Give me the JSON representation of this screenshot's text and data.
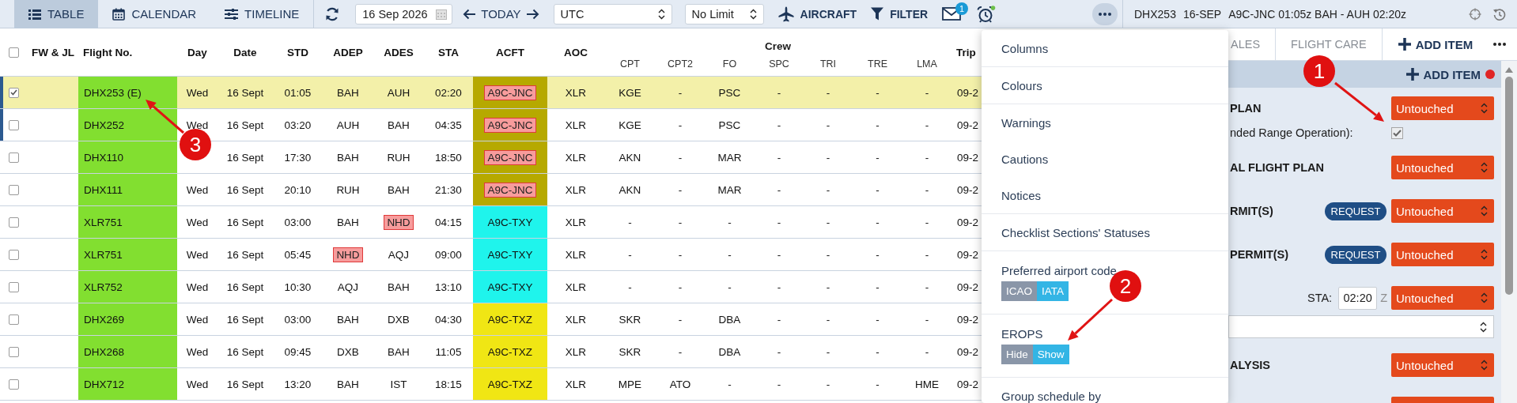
{
  "toolbar": {
    "views": [
      {
        "kind": "table",
        "label": "TABLE",
        "selected": true
      },
      {
        "kind": "calendar",
        "label": "CALENDAR",
        "selected": false
      },
      {
        "kind": "timeline",
        "label": "TIMELINE",
        "selected": false
      }
    ],
    "date": "16 Sep 2026",
    "today": "TODAY",
    "timezone": "UTC",
    "limit": "No Limit",
    "aircraft": "AIRCRAFT",
    "filter": "FILTER",
    "messages_badge": "1"
  },
  "flight_info": [
    "DHX253",
    "16-SEP",
    "A9C-JNC 01:05z BAH - AUH 02:20z"
  ],
  "table": {
    "all_selected": false,
    "columns": [
      "FW & JL",
      "Flight No.",
      "Day",
      "Date",
      "STD",
      "ADEP",
      "ADES",
      "STA",
      "ACFT",
      "AOC"
    ],
    "crew_group": {
      "label": "Crew",
      "columns": [
        "CPT",
        "CPT2",
        "FO",
        "SPC",
        "TRI",
        "TRE",
        "LMA"
      ]
    },
    "trip_column": "Trip",
    "rows": [
      {
        "selected": true,
        "marked": true,
        "flight": "DHX253 (E)",
        "day": "Wed",
        "date": "16 Sept",
        "std": "01:05",
        "adep": "BAH",
        "adep_alert": false,
        "ades": "AUH",
        "ades_alert": false,
        "sta": "02:20",
        "acft": "A9C-JNC",
        "acft_alert": true,
        "color": "#b6a900",
        "aoc": "XLR",
        "crew": [
          "KGE",
          "-",
          "PSC",
          "-",
          "-",
          "-",
          "-"
        ],
        "trip": "09-2"
      },
      {
        "selected": false,
        "marked": true,
        "flight": "DHX252",
        "day": "Wed",
        "date": "16 Sept",
        "std": "03:20",
        "adep": "AUH",
        "adep_alert": false,
        "ades": "BAH",
        "ades_alert": false,
        "sta": "04:35",
        "acft": "A9C-JNC",
        "acft_alert": true,
        "color": "#b6a900",
        "aoc": "XLR",
        "crew": [
          "KGE",
          "-",
          "PSC",
          "-",
          "-",
          "-",
          "-"
        ],
        "trip": "09-2"
      },
      {
        "selected": false,
        "marked": false,
        "flight": "DHX110",
        "date": "16 Sept",
        "std": "17:30",
        "adep": "BAH",
        "adep_alert": false,
        "ades": "RUH",
        "ades_alert": false,
        "sta": "18:50",
        "acft": "A9C-JNC",
        "acft_alert": true,
        "color": "#b6a900",
        "aoc": "XLR",
        "crew": [
          "AKN",
          "-",
          "MAR",
          "-",
          "-",
          "-",
          "-"
        ],
        "trip": "09-2"
      },
      {
        "selected": false,
        "marked": false,
        "flight": "DHX111",
        "day": "Wed",
        "date": "16 Sept",
        "std": "20:10",
        "adep": "RUH",
        "adep_alert": false,
        "ades": "BAH",
        "ades_alert": false,
        "sta": "21:30",
        "acft": "A9C-JNC",
        "acft_alert": true,
        "color": "#b6a900",
        "aoc": "XLR",
        "crew": [
          "AKN",
          "-",
          "MAR",
          "-",
          "-",
          "-",
          "-"
        ],
        "trip": "09-2"
      },
      {
        "selected": false,
        "marked": false,
        "flight": "XLR751",
        "day": "Wed",
        "date": "16 Sept",
        "std": "03:00",
        "adep": "BAH",
        "adep_alert": false,
        "ades": "NHD",
        "ades_alert": true,
        "sta": "04:15",
        "acft": "A9C-TXY",
        "acft_alert": false,
        "color": "#1ff4ec",
        "aoc": "XLR",
        "crew": [
          "-",
          "-",
          "-",
          "-",
          "-",
          "-",
          "-"
        ],
        "trip": "09-2"
      },
      {
        "selected": false,
        "marked": false,
        "flight": "XLR751",
        "day": "Wed",
        "date": "16 Sept",
        "std": "05:45",
        "adep": "NHD",
        "adep_alert": true,
        "ades": "AQJ",
        "ades_alert": false,
        "sta": "09:00",
        "acft": "A9C-TXY",
        "acft_alert": false,
        "color": "#1ff4ec",
        "aoc": "XLR",
        "crew": [
          "-",
          "-",
          "-",
          "-",
          "-",
          "-",
          "-"
        ],
        "trip": "09-2"
      },
      {
        "selected": false,
        "marked": false,
        "flight": "XLR752",
        "day": "Wed",
        "date": "16 Sept",
        "std": "10:30",
        "adep": "AQJ",
        "adep_alert": false,
        "ades": "BAH",
        "ades_alert": false,
        "sta": "13:10",
        "acft": "A9C-TXY",
        "acft_alert": false,
        "color": "#1ff4ec",
        "aoc": "XLR",
        "crew": [
          "-",
          "-",
          "-",
          "-",
          "-",
          "-",
          "-"
        ],
        "trip": "09-2"
      },
      {
        "selected": false,
        "marked": false,
        "flight": "DHX269",
        "day": "Wed",
        "date": "16 Sept",
        "std": "03:00",
        "adep": "BAH",
        "adep_alert": false,
        "ades": "DXB",
        "ades_alert": false,
        "sta": "04:30",
        "acft": "A9C-TXZ",
        "acft_alert": false,
        "color": "#f0e614",
        "aoc": "XLR",
        "crew": [
          "SKR",
          "-",
          "DBA",
          "-",
          "-",
          "-",
          "-"
        ],
        "trip": "09-2"
      },
      {
        "selected": false,
        "marked": false,
        "flight": "DHX268",
        "day": "Wed",
        "date": "16 Sept",
        "std": "09:45",
        "adep": "DXB",
        "adep_alert": false,
        "ades": "BAH",
        "ades_alert": false,
        "sta": "11:05",
        "acft": "A9C-TXZ",
        "acft_alert": false,
        "color": "#f0e614",
        "aoc": "XLR",
        "crew": [
          "SKR",
          "-",
          "DBA",
          "-",
          "-",
          "-",
          "-"
        ],
        "trip": "09-2"
      },
      {
        "selected": false,
        "marked": false,
        "flight": "DHX712",
        "day": "Wed",
        "date": "16 Sept",
        "std": "13:20",
        "adep": "BAH",
        "adep_alert": false,
        "ades": "IST",
        "ades_alert": false,
        "sta": "18:15",
        "acft": "A9C-TXZ",
        "acft_alert": false,
        "color": "#f0e614",
        "aoc": "XLR",
        "crew": [
          "MPE",
          "ATO",
          "-",
          "-",
          "-",
          "-",
          "HME"
        ],
        "trip": "09-2"
      }
    ]
  },
  "menu": {
    "sections": [
      [
        {
          "kind": "link",
          "label": "Columns"
        }
      ],
      [
        {
          "kind": "link",
          "label": "Colours"
        }
      ],
      [
        {
          "kind": "link",
          "label": "Warnings"
        },
        {
          "kind": "link",
          "label": "Cautions"
        },
        {
          "kind": "link",
          "label": "Notices"
        }
      ],
      [
        {
          "kind": "link",
          "label": "Checklist Sections' Statuses"
        }
      ],
      [
        {
          "kind": "toggle",
          "label": "Preferred airport code",
          "options": [
            {
              "label": "ICAO",
              "selected": false
            },
            {
              "label": "IATA",
              "selected": true
            }
          ]
        }
      ],
      [
        {
          "kind": "toggle",
          "label": "EROPS",
          "options": [
            {
              "label": "Hide",
              "selected": false
            },
            {
              "label": "Show",
              "selected": true
            }
          ]
        }
      ],
      [
        {
          "kind": "link",
          "label": "Group schedule by"
        }
      ]
    ]
  },
  "panel": {
    "tabs": [
      {
        "label": "ALES",
        "selected": false
      },
      {
        "label": "FLIGHT CARE",
        "selected": false
      }
    ],
    "add_item": "ADD ITEM",
    "header_add_item": "ADD ITEM",
    "rows": [
      {
        "kind": "status",
        "label": "PLAN",
        "status": "Untouched"
      },
      {
        "kind": "checkbox",
        "label": "nded Range Operation):",
        "checked": true
      },
      {
        "kind": "status",
        "label": "AL FLIGHT PLAN",
        "status": "Untouched"
      },
      {
        "kind": "status",
        "label": "RMIT(S)",
        "request": "REQUEST",
        "status": "Untouched"
      },
      {
        "kind": "status",
        "label": "PERMIT(S)",
        "request": "REQUEST",
        "status": "Untouched"
      },
      {
        "kind": "sta",
        "label": "STA:",
        "value": "02:20",
        "suffix": "Z",
        "status": "Untouched"
      },
      {
        "kind": "select"
      },
      {
        "kind": "status",
        "label": "ALYSIS",
        "status": "Untouched"
      },
      {
        "kind": "cut"
      }
    ]
  },
  "annotations": [
    {
      "number": "1"
    },
    {
      "number": "2"
    },
    {
      "number": "3"
    }
  ]
}
